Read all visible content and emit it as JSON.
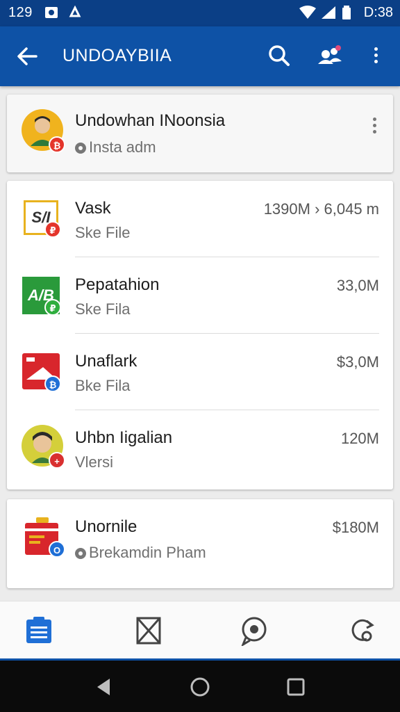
{
  "status_bar": {
    "left_text": "129",
    "time": "D:38"
  },
  "app_bar": {
    "title": "UNDOAYBIIA"
  },
  "account": {
    "name": "Undowhan INoonsia",
    "subtitle": "Insta adm"
  },
  "items": [
    {
      "name": "Vask",
      "subtitle": "Ske File",
      "amount": "1390M › 6,045 m",
      "icon_label": "S/I",
      "icon_color": "#e8b21e",
      "badge_color": "#e4352b"
    },
    {
      "name": "Pepatahion",
      "subtitle": "Ske Fila",
      "amount": "33,0M",
      "icon_label": "A/B",
      "icon_color": "#2a9a3b",
      "badge_color": "#2fae3e"
    },
    {
      "name": "Unaflark",
      "subtitle": "Bke Fila",
      "amount": "$3,0M",
      "icon_label": "",
      "icon_color": "#d8262c",
      "badge_color": "#1f6fd6"
    },
    {
      "name": "Uhbn Iigalian",
      "subtitle": "Vlersi",
      "amount": "120M",
      "icon_label": "",
      "icon_color": "#d4cf3a",
      "badge_color": "#d93030"
    }
  ],
  "featured": {
    "name": "Unornile",
    "subtitle": "Brekamdin Pham",
    "amount": "$180M",
    "badge_color": "#1f6fd6"
  },
  "colors": {
    "primary": "#0e52a6",
    "status": "#0b3f86"
  }
}
